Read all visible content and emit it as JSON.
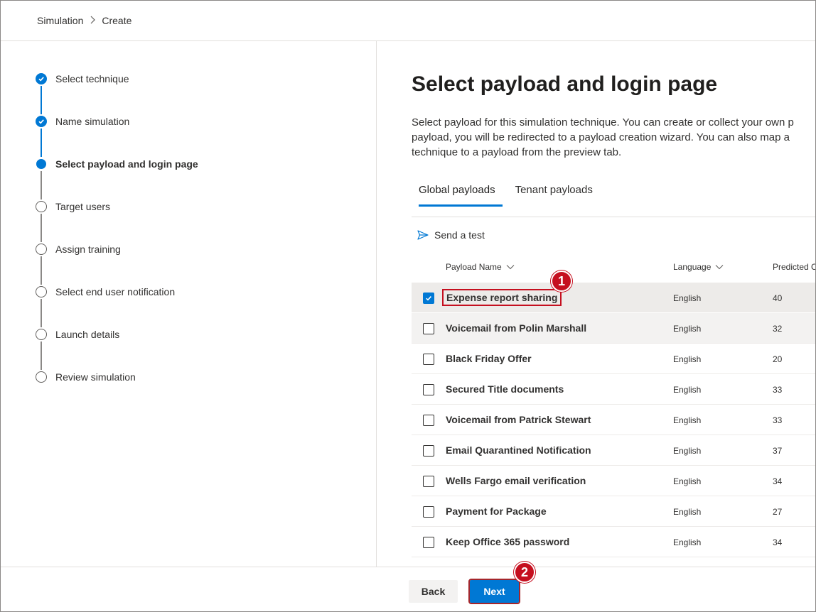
{
  "breadcrumb": {
    "root": "Simulation",
    "current": "Create"
  },
  "wizard": {
    "steps": [
      {
        "label": "Select technique",
        "state": "done"
      },
      {
        "label": "Name simulation",
        "state": "done"
      },
      {
        "label": "Select payload and login page",
        "state": "current"
      },
      {
        "label": "Target users",
        "state": "pending"
      },
      {
        "label": "Assign training",
        "state": "pending"
      },
      {
        "label": "Select end user notification",
        "state": "pending"
      },
      {
        "label": "Launch details",
        "state": "pending"
      },
      {
        "label": "Review simulation",
        "state": "pending"
      }
    ]
  },
  "main": {
    "title": "Select payload and login page",
    "description_lines": [
      "Select payload for this simulation technique. You can create or collect your own p",
      "payload, you will be redirected to a payload creation wizard. You can also map a",
      "technique to a payload from the preview tab."
    ],
    "tabs": [
      {
        "label": "Global payloads",
        "active": true
      },
      {
        "label": "Tenant payloads",
        "active": false
      }
    ],
    "send_test_label": "Send a test",
    "table": {
      "columns": {
        "name": "Payload Name",
        "language": "Language",
        "predicted": "Predicted C"
      },
      "rows": [
        {
          "name": "Expense report sharing",
          "language": "English",
          "predicted": "40",
          "checked": true
        },
        {
          "name": "Voicemail from Polin Marshall",
          "language": "English",
          "predicted": "32",
          "checked": false
        },
        {
          "name": "Black Friday Offer",
          "language": "English",
          "predicted": "20",
          "checked": false
        },
        {
          "name": "Secured Title documents",
          "language": "English",
          "predicted": "33",
          "checked": false
        },
        {
          "name": "Voicemail from Patrick Stewart",
          "language": "English",
          "predicted": "33",
          "checked": false
        },
        {
          "name": "Email Quarantined Notification",
          "language": "English",
          "predicted": "37",
          "checked": false
        },
        {
          "name": "Wells Fargo email verification",
          "language": "English",
          "predicted": "34",
          "checked": false
        },
        {
          "name": "Payment for Package",
          "language": "English",
          "predicted": "27",
          "checked": false
        },
        {
          "name": "Keep Office 365 password",
          "language": "English",
          "predicted": "34",
          "checked": false
        }
      ]
    }
  },
  "footer": {
    "back_label": "Back",
    "next_label": "Next"
  },
  "annotations": {
    "marker1": "1",
    "marker2": "2"
  },
  "colors": {
    "accent": "#0078d4",
    "annotation": "#c50f1f"
  }
}
